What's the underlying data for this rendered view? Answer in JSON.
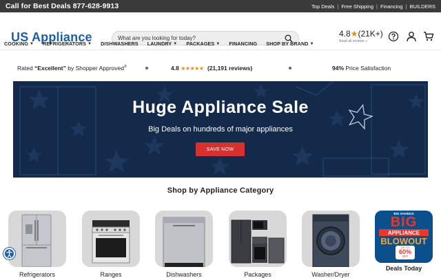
{
  "topbar": {
    "call": "Call for Best Deals 877-628-9913",
    "links": [
      "Top Deals",
      "Free Shipping",
      "Financing",
      "BUILDERS"
    ]
  },
  "header": {
    "logo": "US Appliance",
    "search_placeholder": "What are you looking for today?",
    "rating_value": "4.8",
    "rating_count": "(21K+)",
    "rating_sub": "Read all reviews »"
  },
  "nav": [
    {
      "label": "COOKING",
      "caret": true
    },
    {
      "label": "REFRIGERATORS",
      "caret": true
    },
    {
      "label": "DISHWASHERS",
      "caret": false
    },
    {
      "label": "LAUNDRY",
      "caret": true
    },
    {
      "label": "PACKAGES",
      "caret": true
    },
    {
      "label": "FINANCING",
      "caret": false
    },
    {
      "label": "SHOP BY BRAND",
      "caret": true
    }
  ],
  "trust": {
    "rated_prefix": "Rated ",
    "rated_strong": "“Excellent”",
    "rated_suffix": " by Shopper Approved",
    "reg": "®",
    "score": "4.8",
    "stars": "★★★★★",
    "reviews": "(21,191 reviews)",
    "satisfaction_pct": "94%",
    "satisfaction_text": " Price Satisfaction"
  },
  "hero": {
    "title": "Huge Appliance Sale",
    "subtitle": "Big Deals on hundreds of major appliances",
    "button": "SAVE NOW"
  },
  "categories_title": "Shop by Appliance Category",
  "categories": [
    {
      "label": "Refrigerators"
    },
    {
      "label": "Ranges"
    },
    {
      "label": "Dishwashers"
    },
    {
      "label": "Packages"
    },
    {
      "label": "Washer/Dryer"
    }
  ],
  "deals": {
    "badge_top": "BIG SAVINGS",
    "big": "BIG",
    "appliance": "APPLIANCE",
    "blowout": "BLOWOUT",
    "up_to": "UP TO",
    "pct": "60%",
    "off": "OFF",
    "label": "Deals Today"
  },
  "colors": {
    "brand_blue": "#1e5fa8",
    "topbar_bg": "#3a3a3a",
    "hero_bg": "#132a4b",
    "cta_red": "#d7312f",
    "star_orange": "#e28b16"
  }
}
